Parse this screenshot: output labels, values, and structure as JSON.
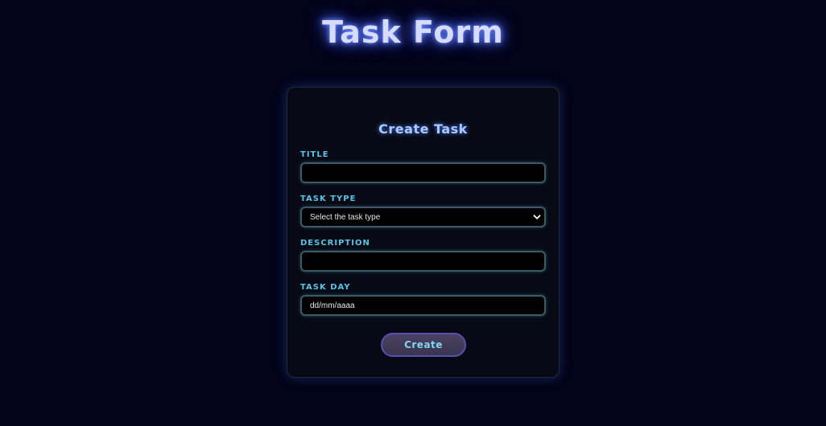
{
  "page": {
    "title": "Task Form"
  },
  "form": {
    "heading": "Create Task",
    "fields": {
      "title": {
        "label": "TITLE",
        "value": ""
      },
      "task_type": {
        "label": "TASK TYPE",
        "selected": "Select the task type"
      },
      "description": {
        "label": "DESCRIPTION",
        "value": ""
      },
      "task_day": {
        "label": "TASK DAY",
        "value": "dd/mm/aaaa"
      }
    },
    "submit_label": "Create"
  },
  "colors": {
    "background": "#03031a",
    "title_glow": "#6f8cff",
    "label": "#58c4e8",
    "button_border": "#5a4fb0"
  },
  "icons": {
    "select_chevron": "chevron-down-icon"
  }
}
